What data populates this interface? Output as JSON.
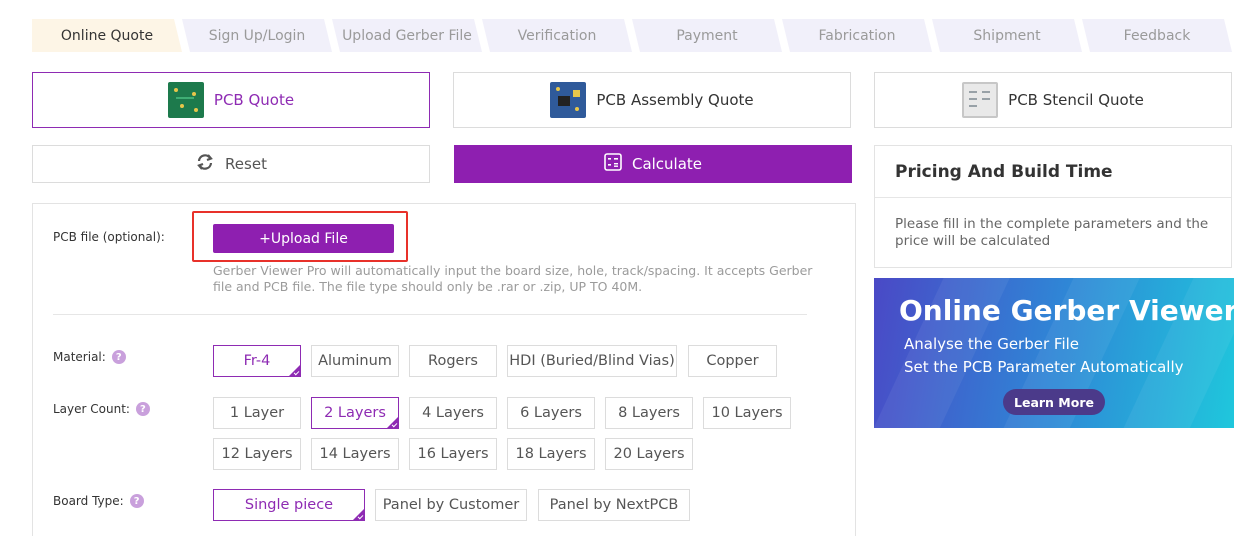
{
  "steps": [
    "Online Quote",
    "Sign Up/Login",
    "Upload Gerber File",
    "Verification",
    "Payment",
    "Fabrication",
    "Shipment",
    "Feedback"
  ],
  "tabs": {
    "pcb": {
      "label": "PCB Quote",
      "icon": "pcb-board-icon"
    },
    "assembly": {
      "label": "PCB Assembly Quote",
      "icon": "pcb-assembly-icon"
    },
    "stencil": {
      "label": "PCB Stencil Quote",
      "icon": "stencil-icon"
    }
  },
  "actions": {
    "reset": "Reset",
    "calculate": "Calculate"
  },
  "form": {
    "pcb_file": {
      "label": "PCB file (optional):",
      "upload": "+Upload File",
      "hint": "Gerber Viewer Pro will automatically input the board size, hole, track/spacing. It accepts Gerber file and PCB file. The file type should only be .rar or .zip, UP TO 40M."
    },
    "material": {
      "label": "Material:",
      "options": [
        "Fr-4",
        "Aluminum",
        "Rogers",
        "HDI (Buried/Blind Vias)",
        "Copper"
      ],
      "selected": "Fr-4"
    },
    "layer_count": {
      "label": "Layer Count:",
      "options": [
        "1 Layer",
        "2 Layers",
        "4 Layers",
        "6 Layers",
        "8 Layers",
        "10 Layers",
        "12 Layers",
        "14 Layers",
        "16 Layers",
        "18 Layers",
        "20 Layers"
      ],
      "selected": "2 Layers"
    },
    "board_type": {
      "label": "Board Type:",
      "options": [
        "Single piece",
        "Panel by Customer",
        "Panel by NextPCB"
      ],
      "selected": "Single piece"
    }
  },
  "pricing": {
    "title": "Pricing And Build Time",
    "message": "Please fill in the complete parameters and the price will be calculated"
  },
  "banner": {
    "title": "Online Gerber Viewer",
    "line1": "Analyse the Gerber File",
    "line2": "Set the PCB Parameter Automatically",
    "cta": "Learn More"
  },
  "colors": {
    "accent": "#8e1fb0",
    "highlight": "#e8312a",
    "step_active": "#fdf5e6",
    "step_bg": "#f1f0fa"
  }
}
